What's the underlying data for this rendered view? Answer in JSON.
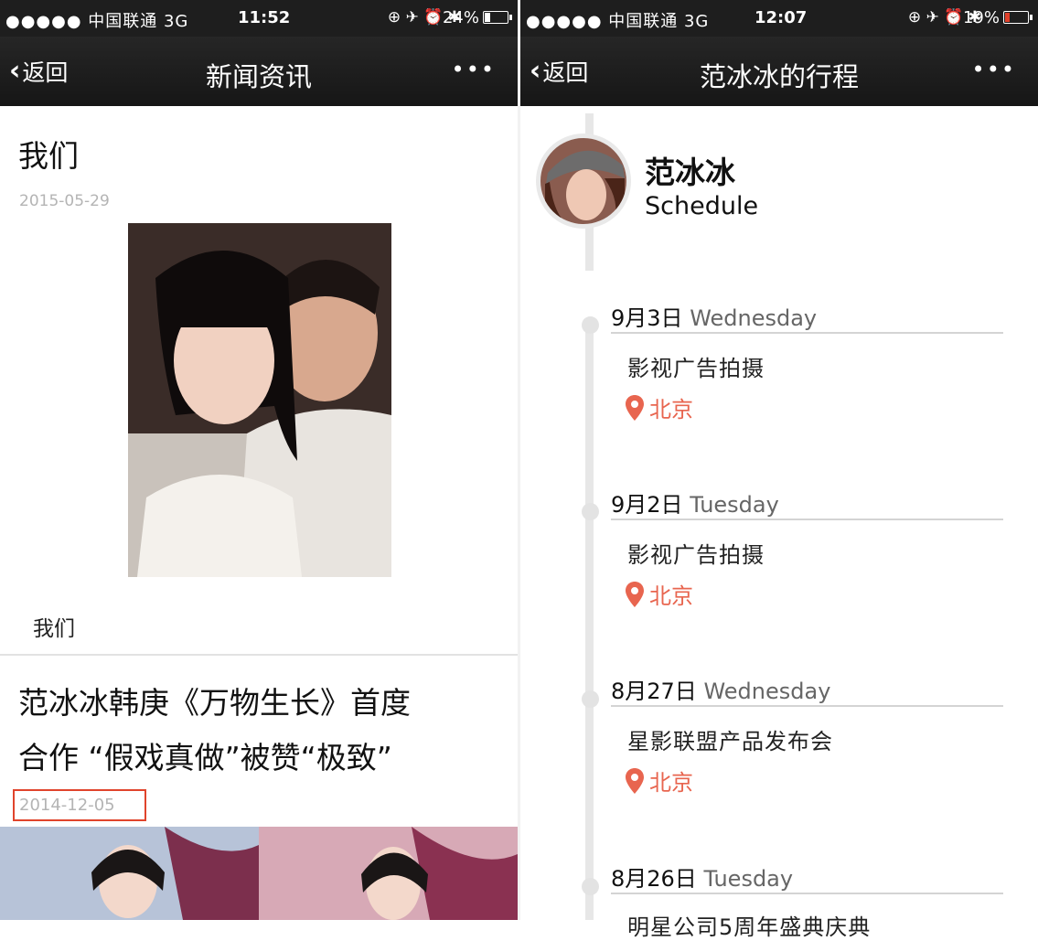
{
  "left": {
    "status": {
      "signal": "●●●●● 中国联通 3G",
      "time": "11:52",
      "icons": "⊕ ✈ ⏰ ✱",
      "battery": "24%",
      "battery_level": 0.24
    },
    "nav": {
      "back": "返回",
      "title": "新闻资讯",
      "more": "•••"
    },
    "articles": [
      {
        "title": "我们",
        "date": "2015-05-29",
        "caption": "我们"
      },
      {
        "title_line1": "范冰冰韩庚《万物生长》首度",
        "title_line2": "合作 “假戏真做”被赞“极致”",
        "date": "2014-12-05"
      }
    ]
  },
  "right": {
    "status": {
      "signal": "●●●●● 中国联通 3G",
      "time": "12:07",
      "icons": "⊕ ✈ ⏰ ✱",
      "battery": "19%",
      "battery_level": 0.19
    },
    "nav": {
      "back": "返回",
      "title": "范冰冰的行程",
      "more": "•••"
    },
    "profile": {
      "name": "范冰冰",
      "subtitle": "Schedule"
    },
    "days": [
      {
        "date": "9月3日",
        "weekday": "Wednesday",
        "event": "影视广告拍摄",
        "location": "北京"
      },
      {
        "date": "9月2日",
        "weekday": "Tuesday",
        "event": "影视广告拍摄",
        "location": "北京"
      },
      {
        "date": "8月27日",
        "weekday": "Wednesday",
        "event": "星影联盟产品发布会",
        "location": "北京"
      },
      {
        "date": "8月26日",
        "weekday": "Tuesday",
        "event": "明星公司5周年盛典庆典"
      }
    ]
  },
  "colors": {
    "bar": "#1e1e1e",
    "accent": "#e8654f",
    "highlight_box": "#e0442c",
    "date_gray": "#b4b4b4"
  }
}
